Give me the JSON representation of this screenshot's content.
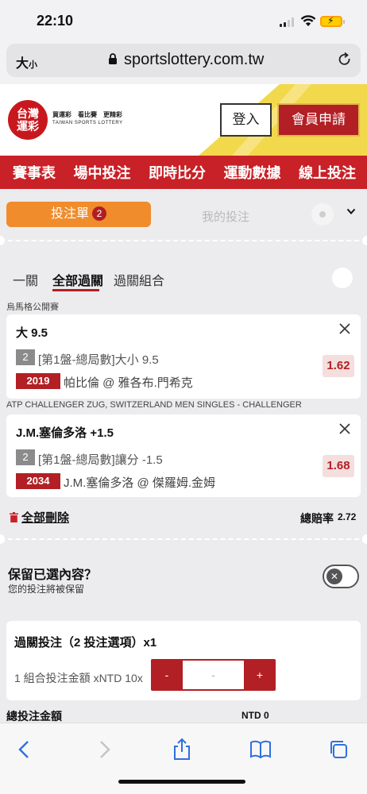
{
  "status_bar": {
    "time": "22:10"
  },
  "browser": {
    "text_size_label": "大",
    "text_size_small": "小",
    "url": "sportslottery.com.tw"
  },
  "site": {
    "logo_line1": "台灣",
    "logo_line2": "運彩",
    "tagline": "買運彩　看比賽　更精彩",
    "tagline_en": "TAIWAN SPORTS LOTTERY",
    "login_label": "登入",
    "register_label": "會員申請"
  },
  "nav": {
    "items": [
      "賽事表",
      "場中投注",
      "即時比分",
      "運動數據",
      "線上投注"
    ]
  },
  "betslip": {
    "tab_label": "投注單",
    "tab_count": "2",
    "my_bets_label": "我的投注",
    "bet_types": [
      "一關",
      "全部過關",
      "過關組合"
    ],
    "selections": [
      {
        "league": "烏馬格公開賽",
        "title": "大 9.5",
        "num": "2",
        "market": "[第1盤-總局數]大小 9.5",
        "code": "2019",
        "match": "帕比倫 @ 雅各布.門希克",
        "odds": "1.62"
      },
      {
        "league": "ATP CHALLENGER ZUG, SWITZERLAND MEN SINGLES - CHALLENGER",
        "title": "J.M.塞倫多洛 +1.5",
        "num": "2",
        "market": "[第1盤-總局數]讓分 -1.5",
        "code": "2034",
        "match": "J.M.塞倫多洛 @ 傑羅姆.金姆",
        "odds": "1.68"
      }
    ],
    "delete_all_label": "全部刪除",
    "total_odds_label": "總賠率",
    "total_odds_value": "2.72",
    "keep_title": "保留已選內容？",
    "keep_sub": "您的投注將被保留",
    "parlay_title": "過關投注（2 投注選項）x1",
    "parlay_amount_label": "1 組合投注金額 xNTD 10x",
    "stepper_minus": "-",
    "stepper_value": "-",
    "stepper_plus": "+",
    "total_amount_label": "總投注金額",
    "total_amount_value": "NTD 0"
  },
  "colors": {
    "brand_red": "#c82127",
    "accent_orange": "#f08c2c",
    "brand_yellow": "#f2d84b"
  }
}
